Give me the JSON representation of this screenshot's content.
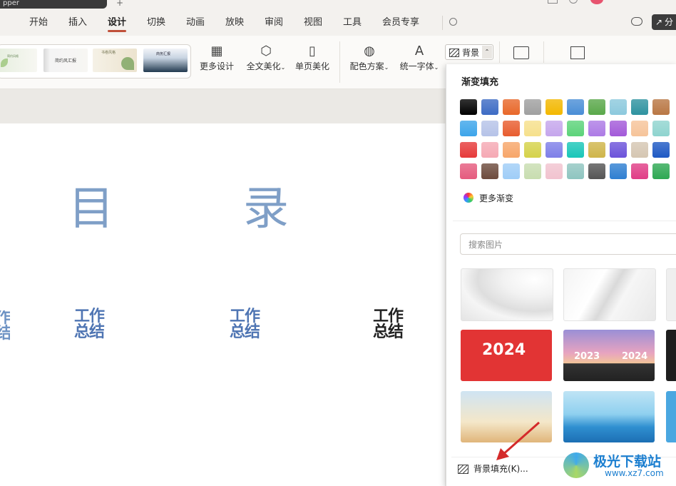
{
  "app_tab": {
    "label": "pper"
  },
  "menu": [
    "开始",
    "插入",
    "设计",
    "切换",
    "动画",
    "放映",
    "审阅",
    "视图",
    "工具",
    "会员专享"
  ],
  "share_label": "分",
  "templates": [
    {
      "title": "简约风格"
    },
    {
      "title": "简约风汇报"
    },
    {
      "title": "书卷风格"
    },
    {
      "title": "商务汇报"
    }
  ],
  "ribbon": {
    "more_design": "更多设计",
    "full_beautify": "全文美化",
    "page_beautify": "单页美化",
    "color_scheme": "配色方案",
    "unify_font": "统一字体",
    "background": "背景"
  },
  "slide": {
    "title_char_1": "目",
    "title_char_2": "录",
    "items": [
      "工作\n总结",
      "工作\n总结",
      "工作\n总结"
    ],
    "left_cut": "作\n结"
  },
  "panel": {
    "section_title": "渐变填充",
    "more_gradients": "更多渐变",
    "search_placeholder": "搜索图片",
    "img_2024_a": "2024",
    "img_2023": "2023",
    "img_2024_b": "2024",
    "bg_fill": "背景填充(K)..."
  },
  "watermark": {
    "name": "极光下载站",
    "url": "www.xz7.com"
  },
  "swatches": [
    [
      "#000000",
      "#3d6bc4",
      "#e8682a",
      "#a0a0a0",
      "#f3b800",
      "#4a8ed6",
      "#5aa84a",
      "#8cc9dd",
      "#2e93a0",
      "#b97744"
    ],
    [
      "#3da5ea",
      "#b6c3e8",
      "#e85d2f",
      "#f6e08c",
      "#c5a6ec",
      "#5cd37a",
      "#ad7be5",
      "#a35ad9",
      "#f6c49a",
      "#8fd4cf"
    ],
    [
      "#e63a3a",
      "#f5a9b4",
      "#f7a66a",
      "#d5d24a",
      "#7e7fe8",
      "#19c6b8",
      "#cfb54a",
      "#6c53da",
      "#d5c6b2",
      "#1e59c4"
    ],
    [
      "#e55b7e",
      "#6d4b3d",
      "#9fcdf7",
      "#c8ddb0",
      "#f1c3cf",
      "#8fc5c0",
      "#555555",
      "#2f7fd1",
      "#e03d86",
      "#2ea853"
    ]
  ]
}
